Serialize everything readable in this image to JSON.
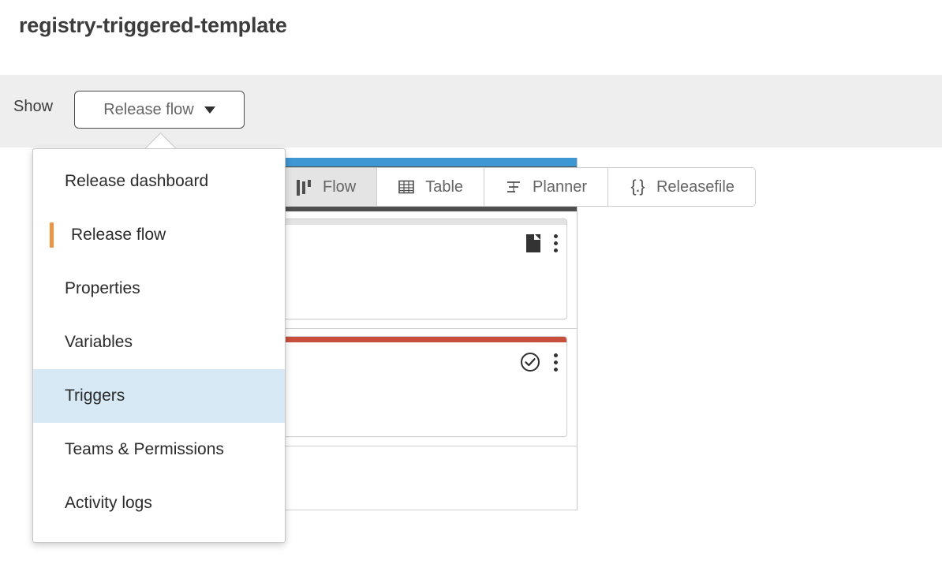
{
  "page": {
    "title": "registry-triggered-template"
  },
  "toolbar": {
    "show_label": "Show",
    "view_select": {
      "value": "Release flow",
      "caret_icon": "chevron-down-icon",
      "expanded": true
    },
    "tabs": [
      {
        "label": "Flow",
        "icon": "flow-icon",
        "active": true
      },
      {
        "label": "Table",
        "icon": "table-icon",
        "active": false
      },
      {
        "label": "Planner",
        "icon": "planner-icon",
        "active": false
      },
      {
        "label": "Releasefile",
        "icon": "releasefile-icon",
        "active": false
      }
    ]
  },
  "dropdown_menu": {
    "items": [
      {
        "label": "Release dashboard",
        "state": "normal"
      },
      {
        "label": "Release flow",
        "state": "current"
      },
      {
        "label": "Properties",
        "state": "normal"
      },
      {
        "label": "Variables",
        "state": "normal"
      },
      {
        "label": "Triggers",
        "state": "highlighted"
      },
      {
        "label": "Teams & Permissions",
        "state": "normal"
      },
      {
        "label": "Activity logs",
        "state": "normal"
      }
    ]
  },
  "canvas": {
    "phase": {
      "accent_color": "#3d97d3",
      "header_color": "#4f4f4f",
      "tasks": [
        {
          "accent_color": "#e3e3e3",
          "status_icon": "document-icon",
          "menu_icon": "kebab-menu-icon"
        },
        {
          "accent_color": "#c94f3d",
          "status_icon": "check-circle-icon",
          "menu_icon": "kebab-menu-icon"
        }
      ]
    }
  },
  "colors": {
    "accent_blue": "#3d97d3",
    "accent_red": "#c94f3d",
    "accent_orange": "#f0943f",
    "highlight_blue": "#d6e9f4",
    "toolbar_bg": "#eeeeee",
    "header_dark": "#4f4f4f"
  }
}
